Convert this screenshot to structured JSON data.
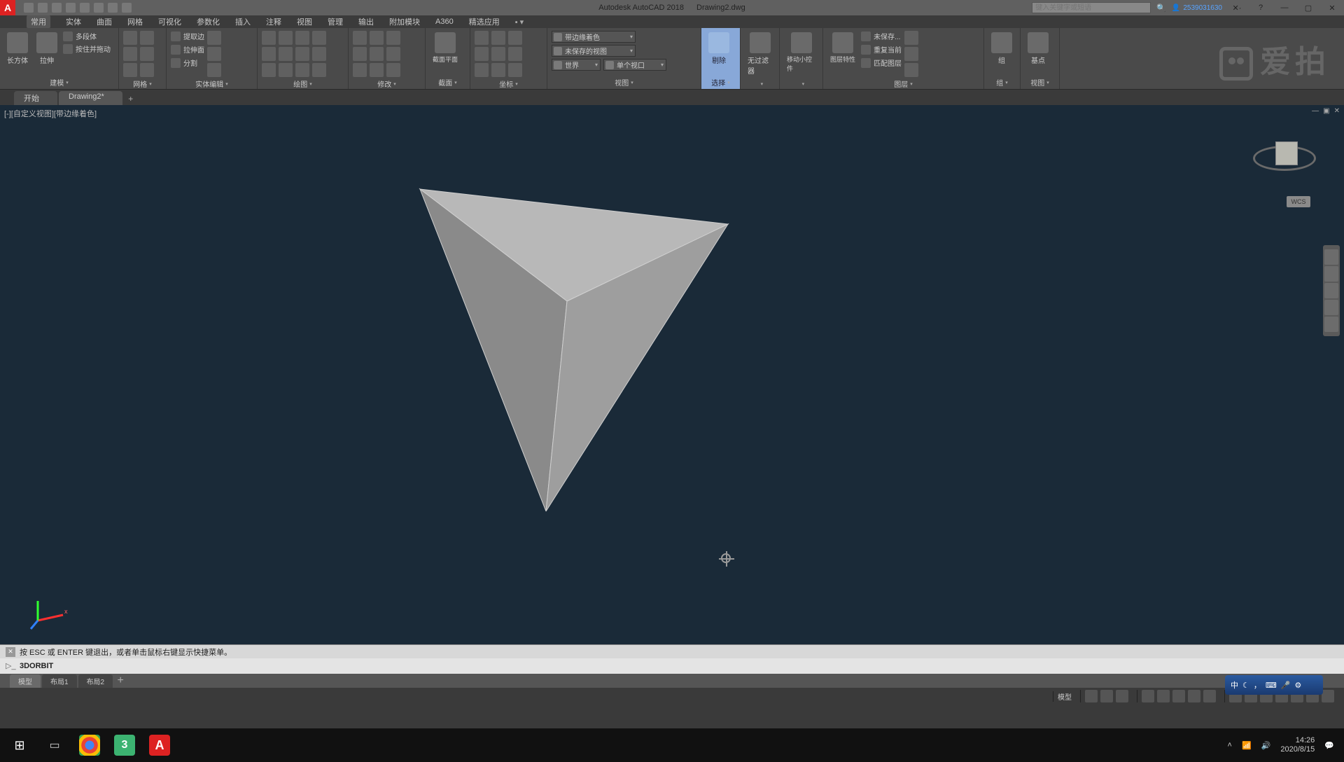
{
  "title": {
    "app": "Autodesk AutoCAD 2018",
    "doc": "Drawing2.dwg"
  },
  "search_placeholder": "键入关键字或短语",
  "account_id": "2539031630",
  "menus": [
    "常用",
    "实体",
    "曲面",
    "网格",
    "可视化",
    "参数化",
    "插入",
    "注释",
    "视图",
    "管理",
    "输出",
    "附加模块",
    "A360",
    "精选应用"
  ],
  "ribbon": {
    "g1": {
      "title": "建模",
      "big": [
        {
          "lbl": "长方体"
        },
        {
          "lbl": "拉伸"
        }
      ],
      "rows": [
        "多段体",
        "按住并拖动"
      ]
    },
    "g2": {
      "title": "网格"
    },
    "g3": {
      "title": "实体编辑",
      "rows": [
        "提取边",
        "拉伸面",
        "分割"
      ]
    },
    "g4": {
      "title": "绘图"
    },
    "g5": {
      "title": "修改"
    },
    "g6": {
      "title": "截面",
      "big": "截面平面"
    },
    "g7": {
      "title": "坐标"
    },
    "g8": {
      "title": "视图",
      "combo1": "带边缘着色",
      "combo2": "未保存的视图",
      "combo3": "世界",
      "combo4": "单个视口"
    },
    "g9": {
      "title": "选择",
      "big1": "剔除",
      "big2": "无过滤器",
      "big3": "移动小控件"
    },
    "g10": {
      "title": "图层",
      "big": "图层特性",
      "rows": [
        "未保存...",
        "重复当前",
        "匹配图层"
      ]
    },
    "g11": {
      "title": "组",
      "big": "组"
    },
    "g12": {
      "title": "视图",
      "big": "基点"
    }
  },
  "doc_tabs": [
    "开始",
    "Drawing2*"
  ],
  "viewport_label": "[-][自定义视图][带边缘着色]",
  "wcs": "WCS",
  "cmd_hint": "按 ESC 或 ENTER 键退出，或者单击鼠标右键显示快捷菜单。",
  "cmd_active": "3DORBIT",
  "layout_tabs": [
    "模型",
    "布局1",
    "布局2"
  ],
  "status": {
    "model": "模型"
  },
  "ime": "中",
  "clock": {
    "time": "14:26",
    "date": "2020/8/15"
  },
  "watermark": "爱拍"
}
